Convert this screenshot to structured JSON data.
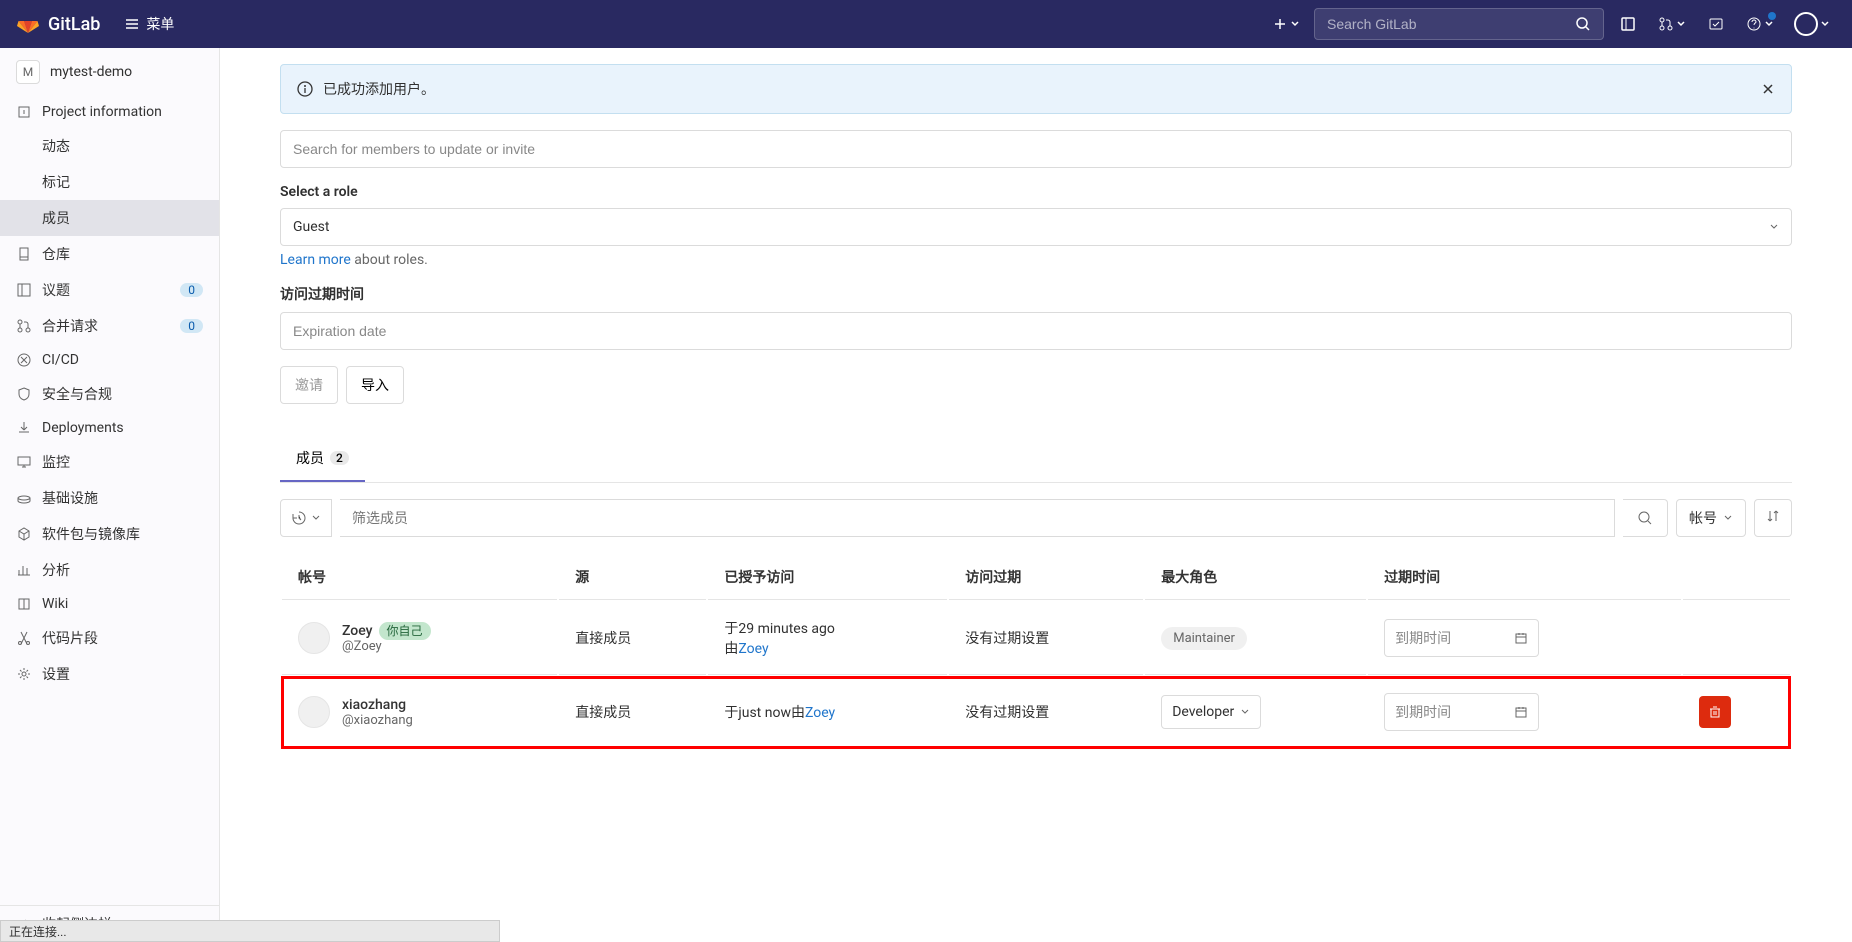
{
  "navbar": {
    "brand": "GitLab",
    "menu_label": "菜单",
    "search_placeholder": "Search GitLab"
  },
  "sidebar": {
    "project_letter": "M",
    "project_name": "mytest-demo",
    "items": [
      {
        "label": "Project information",
        "icon": "info"
      },
      {
        "label": "动态",
        "sub": true
      },
      {
        "label": "标记",
        "sub": true
      },
      {
        "label": "成员",
        "sub": true,
        "active": true
      },
      {
        "label": "仓库",
        "icon": "repo"
      },
      {
        "label": "议题",
        "icon": "issues",
        "badge": "0"
      },
      {
        "label": "合并请求",
        "icon": "merge",
        "badge": "0"
      },
      {
        "label": "CI/CD",
        "icon": "cicd"
      },
      {
        "label": "安全与合规",
        "icon": "shield"
      },
      {
        "label": "Deployments",
        "icon": "deploy"
      },
      {
        "label": "监控",
        "icon": "monitor"
      },
      {
        "label": "基础设施",
        "icon": "infra"
      },
      {
        "label": "软件包与镜像库",
        "icon": "package"
      },
      {
        "label": "分析",
        "icon": "analytics"
      },
      {
        "label": "Wiki",
        "icon": "wiki"
      },
      {
        "label": "代码片段",
        "icon": "snippet"
      },
      {
        "label": "设置",
        "icon": "settings"
      }
    ],
    "collapse_label": "收起侧边栏"
  },
  "alert": {
    "message": "已成功添加用户。"
  },
  "form": {
    "search_placeholder": "Search for members to update or invite",
    "role_label": "Select a role",
    "role_value": "Guest",
    "learn_more": "Learn more",
    "about_roles": " about roles.",
    "expiry_label": "访问过期时间",
    "expiry_placeholder": "Expiration date",
    "invite_btn": "邀请",
    "import_btn": "导入"
  },
  "tabs": {
    "members_label": "成员",
    "members_count": "2"
  },
  "filter": {
    "placeholder": "筛选成员",
    "sort_label": "帐号"
  },
  "table": {
    "headers": {
      "account": "帐号",
      "source": "源",
      "access": "已授予访问",
      "expiry": "访问过期",
      "role": "最大角色",
      "exp_time": "过期时间"
    },
    "rows": [
      {
        "name": "Zoey",
        "username": "@Zoey",
        "self_badge": "你自己",
        "source": "直接成员",
        "access_prefix": "于",
        "access_time": "29 minutes ago",
        "access_by_prefix": "由",
        "access_by": "Zoey",
        "expiry": "没有过期设置",
        "role": "Maintainer",
        "role_editable": false,
        "exp_placeholder": "到期时间"
      },
      {
        "name": "xiaozhang",
        "username": "@xiaozhang",
        "source": "直接成员",
        "access_prefix": "于",
        "access_time": "just now",
        "access_by_prefix": "由",
        "access_by": "Zoey",
        "expiry": "没有过期设置",
        "role": "Developer",
        "role_editable": true,
        "exp_placeholder": "到期时间",
        "highlighted": true
      }
    ]
  },
  "status_bar": "正在连接..."
}
